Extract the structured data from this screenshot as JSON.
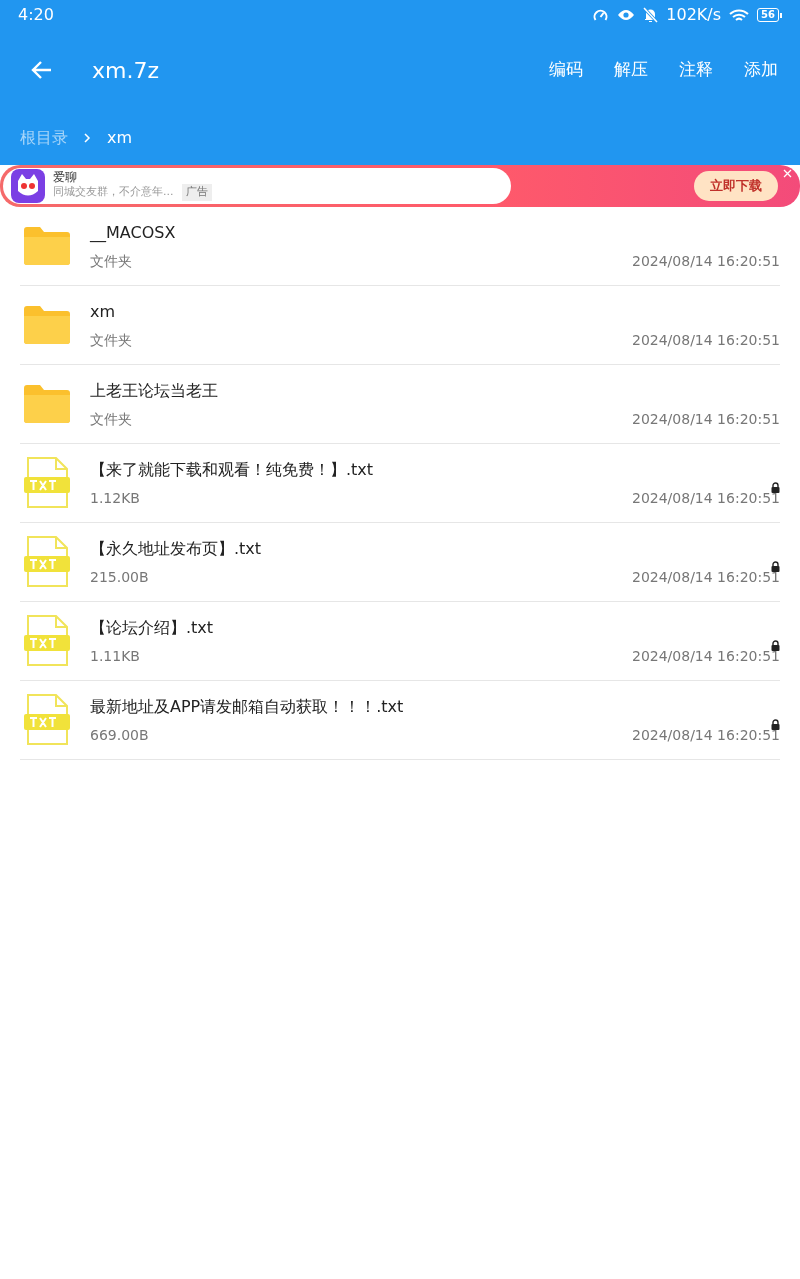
{
  "status_bar": {
    "time": "4:20",
    "speed": "102K/s",
    "battery": "56"
  },
  "toolbar": {
    "title": "xm.7z",
    "actions": [
      "编码",
      "解压",
      "注释",
      "添加"
    ]
  },
  "breadcrumb": [
    "根目录",
    "xm"
  ],
  "ad": {
    "app_name": "爱聊",
    "text": "同城交友群，不介意年...",
    "tag": "广告",
    "button": "立即下载"
  },
  "items": [
    {
      "kind": "folder",
      "name": "__MACOSX",
      "info": "文件夹",
      "date": "2024/08/14 16:20:51",
      "locked": false
    },
    {
      "kind": "folder",
      "name": "xm",
      "info": "文件夹",
      "date": "2024/08/14 16:20:51",
      "locked": false
    },
    {
      "kind": "folder",
      "name": "上老王论坛当老王",
      "info": "文件夹",
      "date": "2024/08/14 16:20:51",
      "locked": false
    },
    {
      "kind": "txt",
      "name": "【来了就能下载和观看！纯免费！】.txt",
      "info": "1.12KB",
      "date": "2024/08/14 16:20:51",
      "locked": true
    },
    {
      "kind": "txt",
      "name": "【永久地址发布页】.txt",
      "info": "215.00B",
      "date": "2024/08/14 16:20:51",
      "locked": true
    },
    {
      "kind": "txt",
      "name": "【论坛介绍】.txt",
      "info": "1.11KB",
      "date": "2024/08/14 16:20:51",
      "locked": true
    },
    {
      "kind": "txt",
      "name": "最新地址及APP请发邮箱自动获取！！！.txt",
      "info": "669.00B",
      "date": "2024/08/14 16:20:51",
      "locked": true
    }
  ]
}
